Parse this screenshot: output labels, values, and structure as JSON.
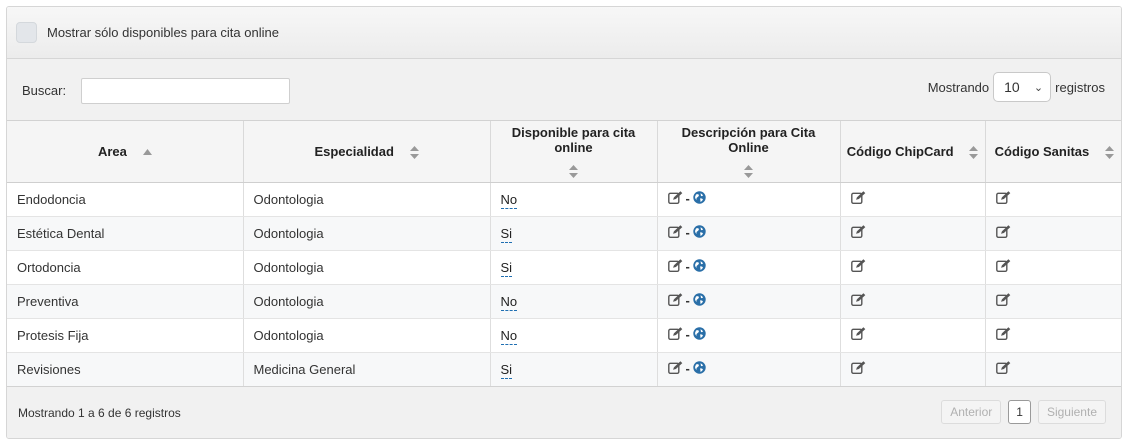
{
  "filter": {
    "label": "Mostrar sólo disponibles para cita online",
    "checked": false
  },
  "controls": {
    "search_label": "Buscar:",
    "search_value": "",
    "length_prefix": "Mostrando",
    "length_value": "10",
    "length_suffix": "registros"
  },
  "table": {
    "columns": [
      "Area",
      "Especialidad",
      "Disponible para cita online",
      "Descripción para Cita Online",
      "Código ChipCard",
      "Código Sanitas"
    ],
    "rows": [
      {
        "area": "Endodoncia",
        "especialidad": "Odontologia",
        "disponible": "No"
      },
      {
        "area": "Estética Dental",
        "especialidad": "Odontologia",
        "disponible": "Si"
      },
      {
        "area": "Ortodoncia",
        "especialidad": "Odontologia",
        "disponible": "Si"
      },
      {
        "area": "Preventiva",
        "especialidad": "Odontologia",
        "disponible": "No"
      },
      {
        "area": "Protesis Fija",
        "especialidad": "Odontologia",
        "disponible": "No"
      },
      {
        "area": "Revisiones",
        "especialidad": "Medicina General",
        "disponible": "Si"
      }
    ],
    "separator": "-"
  },
  "footer": {
    "info": "Mostrando 1 a 6 de 6 registros",
    "prev": "Anterior",
    "page": "1",
    "next": "Siguiente"
  },
  "icons": {
    "edit": "edit-icon",
    "globe": "globe-icon",
    "sort_asc": "sort-asc-icon",
    "sort_both": "sort-both-icon",
    "chevron": "chevron-down-icon"
  },
  "colors": {
    "link_dashed": "#1f6fb2",
    "globe": "#2a6fa8",
    "header_bg": "#f5f5f5"
  }
}
